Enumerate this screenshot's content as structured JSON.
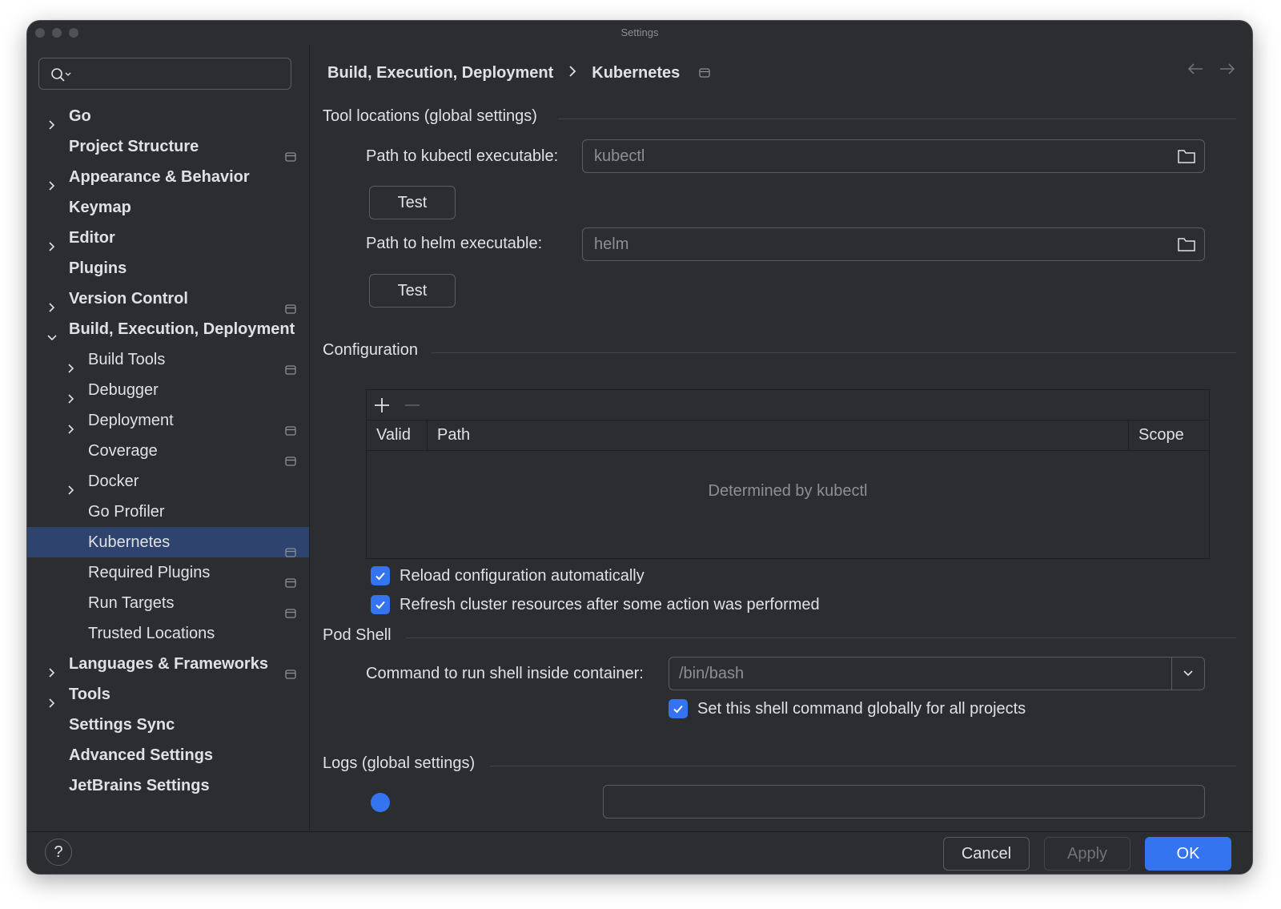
{
  "window": {
    "title": "Settings"
  },
  "search": {
    "placeholder": ""
  },
  "sidebar": {
    "items": [
      {
        "label": "Go",
        "level": 0,
        "chevron": "right",
        "project": false
      },
      {
        "label": "Project Structure",
        "level": 0,
        "chevron": "none",
        "project": true
      },
      {
        "label": "Appearance & Behavior",
        "level": 0,
        "chevron": "right",
        "project": false
      },
      {
        "label": "Keymap",
        "level": 0,
        "chevron": "none",
        "project": false
      },
      {
        "label": "Editor",
        "level": 0,
        "chevron": "right",
        "project": false
      },
      {
        "label": "Plugins",
        "level": 0,
        "chevron": "none",
        "project": false
      },
      {
        "label": "Version Control",
        "level": 0,
        "chevron": "right",
        "project": true
      },
      {
        "label": "Build, Execution, Deployment",
        "level": 0,
        "chevron": "down",
        "project": false
      },
      {
        "label": "Build Tools",
        "level": 1,
        "chevron": "right",
        "project": true
      },
      {
        "label": "Debugger",
        "level": 1,
        "chevron": "right",
        "project": false
      },
      {
        "label": "Deployment",
        "level": 1,
        "chevron": "right",
        "project": true
      },
      {
        "label": "Coverage",
        "level": 1,
        "chevron": "none",
        "project": true
      },
      {
        "label": "Docker",
        "level": 1,
        "chevron": "right",
        "project": false
      },
      {
        "label": "Go Profiler",
        "level": 1,
        "chevron": "none",
        "project": false
      },
      {
        "label": "Kubernetes",
        "level": 1,
        "chevron": "none",
        "project": true,
        "selected": true
      },
      {
        "label": "Required Plugins",
        "level": 1,
        "chevron": "none",
        "project": true
      },
      {
        "label": "Run Targets",
        "level": 1,
        "chevron": "none",
        "project": true
      },
      {
        "label": "Trusted Locations",
        "level": 1,
        "chevron": "none",
        "project": false
      },
      {
        "label": "Languages & Frameworks",
        "level": 0,
        "chevron": "right",
        "project": true
      },
      {
        "label": "Tools",
        "level": 0,
        "chevron": "right",
        "project": false
      },
      {
        "label": "Settings Sync",
        "level": 0,
        "chevron": "none",
        "project": false
      },
      {
        "label": "Advanced Settings",
        "level": 0,
        "chevron": "none",
        "project": false
      },
      {
        "label": "JetBrains Settings",
        "level": 0,
        "chevron": "none",
        "project": false
      }
    ]
  },
  "breadcrumb": {
    "parent": "Build, Execution, Deployment",
    "current": "Kubernetes"
  },
  "tool_locations": {
    "title": "Tool locations (global settings)",
    "kubectl_label": "Path to kubectl executable:",
    "kubectl_value": "kubectl",
    "kubectl_test": "Test",
    "helm_label": "Path to helm executable:",
    "helm_value": "helm",
    "helm_test": "Test"
  },
  "configuration": {
    "title": "Configuration",
    "columns": {
      "valid": "Valid",
      "path": "Path",
      "scope": "Scope"
    },
    "empty_text": "Determined by kubectl",
    "reload_label": "Reload configuration automatically",
    "reload_checked": true,
    "refresh_label": "Refresh cluster resources after some action was performed",
    "refresh_checked": true
  },
  "pod_shell": {
    "title": "Pod Shell",
    "command_label": "Command to run shell inside container:",
    "command_value": "/bin/bash",
    "global_label": "Set this shell command globally for all projects",
    "global_checked": true
  },
  "logs": {
    "title": "Logs (global settings)"
  },
  "footer": {
    "help": "?",
    "cancel": "Cancel",
    "apply": "Apply",
    "ok": "OK"
  },
  "colors": {
    "accent": "#3574f0",
    "selection": "#2e436e",
    "background": "#2b2d30"
  }
}
